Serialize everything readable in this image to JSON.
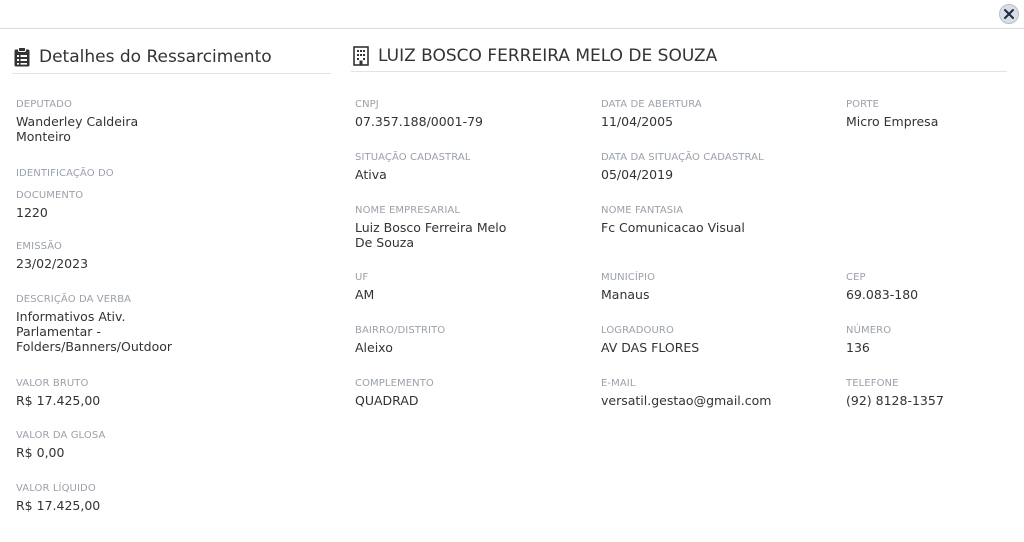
{
  "close": {
    "icon": "close-icon"
  },
  "left_panel": {
    "icon": "clipboard-list-icon",
    "title": "Detalhes do Ressarcimento",
    "fields": {
      "deputado": {
        "label": "DEPUTADO",
        "value_line1": "Wanderley Caldeira",
        "value_line2": "Monteiro"
      },
      "identificacao": {
        "label_line1": "IDENTIFICAÇÃO DO",
        "label_line2": "DOCUMENTO",
        "value": "1220"
      },
      "emissao": {
        "label": "EMISSÃO",
        "value": "23/02/2023"
      },
      "descricao": {
        "label": "DESCRIÇÃO DA VERBA",
        "value_line1": "Informativos Ativ.",
        "value_line2": "Parlamentar -",
        "value_line3": "Folders/Banners/Outdoor"
      },
      "valor_bruto": {
        "label": "VALOR BRUTO",
        "value": "R$ 17.425,00"
      },
      "valor_glosa": {
        "label": "VALOR DA GLOSA",
        "value": "R$ 0,00"
      },
      "valor_liquido": {
        "label": "VALOR LÍQUIDO",
        "value": "R$ 17.425,00"
      }
    }
  },
  "right_panel": {
    "icon": "building-icon",
    "title": "LUIZ BOSCO FERREIRA MELO DE SOUZA",
    "fields": {
      "cnpj": {
        "label": "CNPJ",
        "value": "07.357.188/0001-79"
      },
      "data_abertura": {
        "label": "DATA DE ABERTURA",
        "value": "11/04/2005"
      },
      "porte": {
        "label": "PORTE",
        "value": "Micro Empresa"
      },
      "situacao": {
        "label": "SITUAÇÃO CADASTRAL",
        "value": "Ativa"
      },
      "data_situacao": {
        "label": "DATA DA SITUAÇÃO CADASTRAL",
        "value": "05/04/2019"
      },
      "nome_empresarial": {
        "label": "NOME EMPRESARIAL",
        "value_line1": "Luiz Bosco Ferreira Melo",
        "value_line2": "De Souza"
      },
      "nome_fantasia": {
        "label": "NOME FANTASIA",
        "value": "Fc Comunicacao Visual"
      },
      "uf": {
        "label": "UF",
        "value": "AM"
      },
      "municipio": {
        "label": "MUNICÍPIO",
        "value": "Manaus"
      },
      "cep": {
        "label": "CEP",
        "value": "69.083-180"
      },
      "bairro": {
        "label": "BAIRRO/DISTRITO",
        "value": "Aleixo"
      },
      "logradouro": {
        "label": "LOGRADOURO",
        "value": "AV DAS FLORES"
      },
      "numero": {
        "label": "NÚMERO",
        "value": "136"
      },
      "complemento": {
        "label": "COMPLEMENTO",
        "value": "QUADRAD"
      },
      "email": {
        "label": "E-MAIL",
        "value": "versatil.gestao@gmail.com"
      },
      "telefone": {
        "label": "TELEFONE",
        "value": "(92) 8128-1357"
      }
    }
  }
}
